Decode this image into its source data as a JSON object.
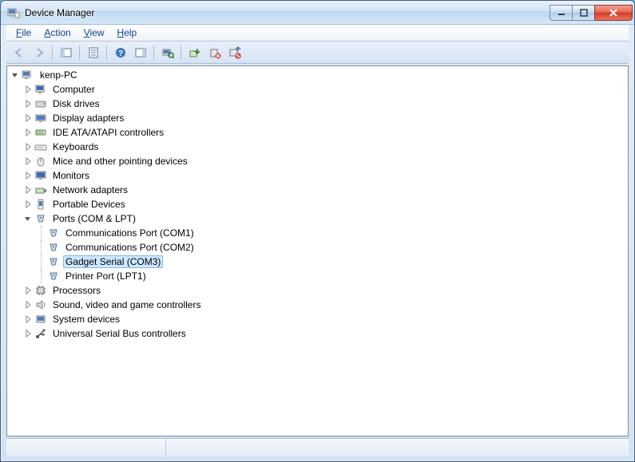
{
  "window": {
    "title": "Device Manager"
  },
  "menu": {
    "file": "File",
    "action": "Action",
    "view": "View",
    "help": "Help"
  },
  "toolbar": {
    "back": "Back",
    "forward": "Forward",
    "show_hide_tree": "Show/Hide Console Tree",
    "properties": "Properties",
    "help": "Help",
    "show_hide_action": "Show/Hide Action Pane",
    "scan": "Scan for hardware changes",
    "update": "Update Driver Software",
    "uninstall": "Uninstall",
    "disable": "Disable"
  },
  "tree": {
    "root": "kenp-PC",
    "items": [
      {
        "label": "Computer"
      },
      {
        "label": "Disk drives"
      },
      {
        "label": "Display adapters"
      },
      {
        "label": "IDE ATA/ATAPI controllers"
      },
      {
        "label": "Keyboards"
      },
      {
        "label": "Mice and other pointing devices"
      },
      {
        "label": "Monitors"
      },
      {
        "label": "Network adapters"
      },
      {
        "label": "Portable Devices"
      },
      {
        "label": "Ports (COM & LPT)",
        "expanded": true,
        "children": [
          {
            "label": "Communications Port (COM1)"
          },
          {
            "label": "Communications Port (COM2)"
          },
          {
            "label": "Gadget Serial (COM3)",
            "selected": true
          },
          {
            "label": "Printer Port (LPT1)"
          }
        ]
      },
      {
        "label": "Processors"
      },
      {
        "label": "Sound, video and game controllers"
      },
      {
        "label": "System devices"
      },
      {
        "label": "Universal Serial Bus controllers"
      }
    ]
  }
}
